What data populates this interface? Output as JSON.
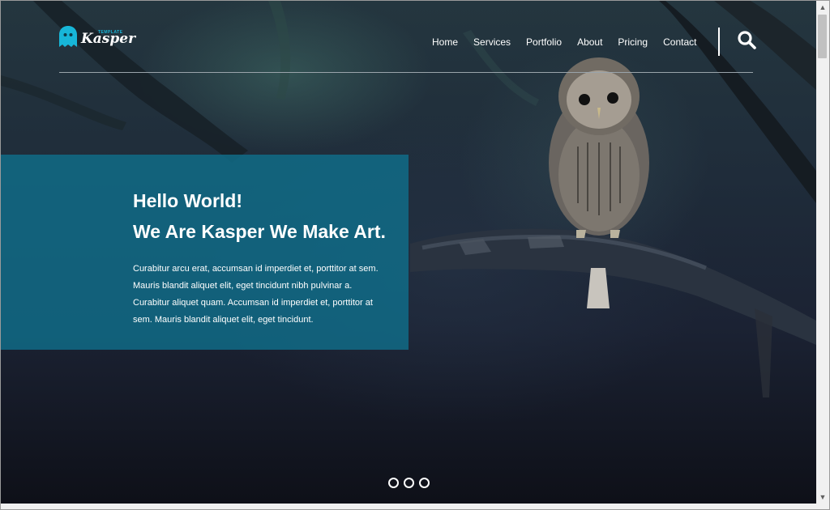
{
  "logo": {
    "name": "Kasper",
    "tagline": "TEMPLATE",
    "ghost_color": "#17b6d8"
  },
  "nav": {
    "items": [
      {
        "label": "Home"
      },
      {
        "label": "Services"
      },
      {
        "label": "Portfolio"
      },
      {
        "label": "About"
      },
      {
        "label": "Pricing"
      },
      {
        "label": "Contact"
      }
    ],
    "search_icon": "search-icon"
  },
  "hero": {
    "headline_line1": "Hello World!",
    "headline_line2": "We Are Kasper We Make Art.",
    "paragraph": "Curabitur arcu erat, accumsan id imperdiet et, porttitor at sem. Mauris blandit aliquet elit, eget tincidunt nibh pulvinar a. Curabitur aliquet quam. Accumsan id imperdiet et, porttitor at sem. Mauris blandit aliquet elit, eget tincidunt.",
    "panel_color": "#106e8a",
    "background_image": "owl-on-branch-night-forest"
  },
  "slider": {
    "dot_count": 3
  },
  "scrollbar": {
    "up_icon": "scroll-up-arrow-icon",
    "down_icon": "scroll-down-arrow-icon"
  }
}
